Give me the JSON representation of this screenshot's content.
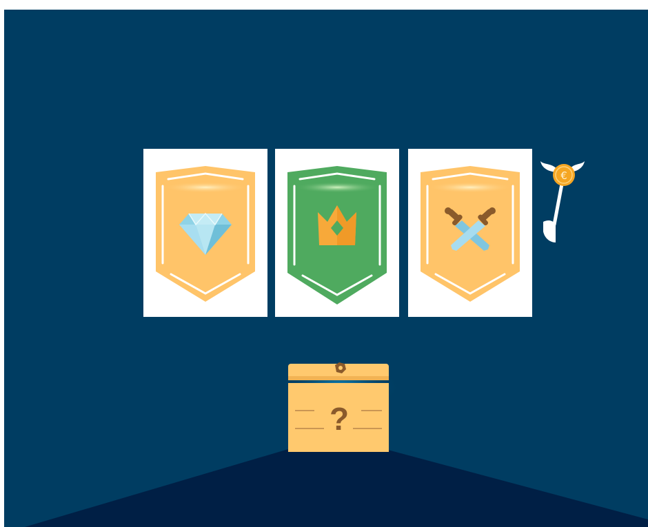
{
  "colors": {
    "background": "#003d62",
    "floor": "#001f45",
    "reel_bg": "#ffffff",
    "shield_gold": "#ffc469",
    "shield_green": "#4faa5f",
    "lever": "#ffffff",
    "coin": "#f5a623",
    "chest": "#ffc96e",
    "chest_mark": "#8a5a2b"
  },
  "slot_machine": {
    "reels": [
      {
        "symbol": "diamond-icon",
        "shield": "gold"
      },
      {
        "symbol": "crown-icon",
        "shield": "green"
      },
      {
        "symbol": "crossed-swords-icon",
        "shield": "gold"
      }
    ],
    "lever": {
      "coin_symbol": "€"
    }
  },
  "chest": {
    "mark": "?"
  }
}
